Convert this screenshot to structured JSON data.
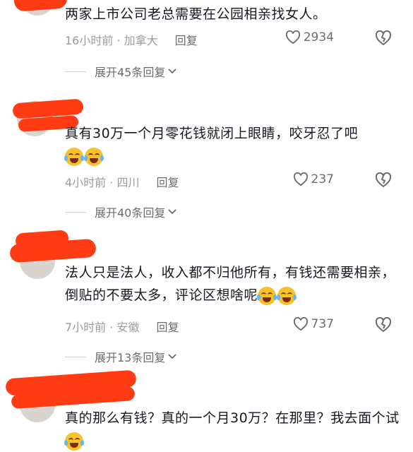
{
  "comments": [
    {
      "text": "两家上市公司老总需要在公园相亲找女人。",
      "time_location": "16小时前 · 加拿大",
      "reply_label": "回复",
      "likes": "2934",
      "expand_label": "展开45条回复"
    },
    {
      "text": "真有30万一个月零花钱就闭上眼睛，咬牙忍了吧",
      "emojis": [
        "laughing-crying-emoji",
        "laughing-crying-emoji"
      ],
      "time_location": "4小时前 · 四川",
      "reply_label": "回复",
      "likes": "237",
      "expand_label": "展开40条回复"
    },
    {
      "text": "法人只是法人，收入都不归他所有，有钱还需要相亲，倒贴的不要太多，评论区想啥呢",
      "emojis": [
        "laughing-crying-emoji",
        "laughing-crying-emoji"
      ],
      "time_location": "7小时前 · 安徽",
      "reply_label": "回复",
      "likes": "737",
      "expand_label": "展开13条回复"
    },
    {
      "text": "真的那么有钱？真的一个月30万？在那里？我去面个试",
      "emojis": [
        "laughing-crying-emoji"
      ]
    }
  ],
  "colors": {
    "text": "#161823",
    "meta": "#9b9b9f",
    "redaction": "#ff3b14"
  },
  "icons": {
    "like": "heart-outline-icon",
    "dislike": "broken-heart-icon",
    "expand": "chevron-down-icon"
  }
}
